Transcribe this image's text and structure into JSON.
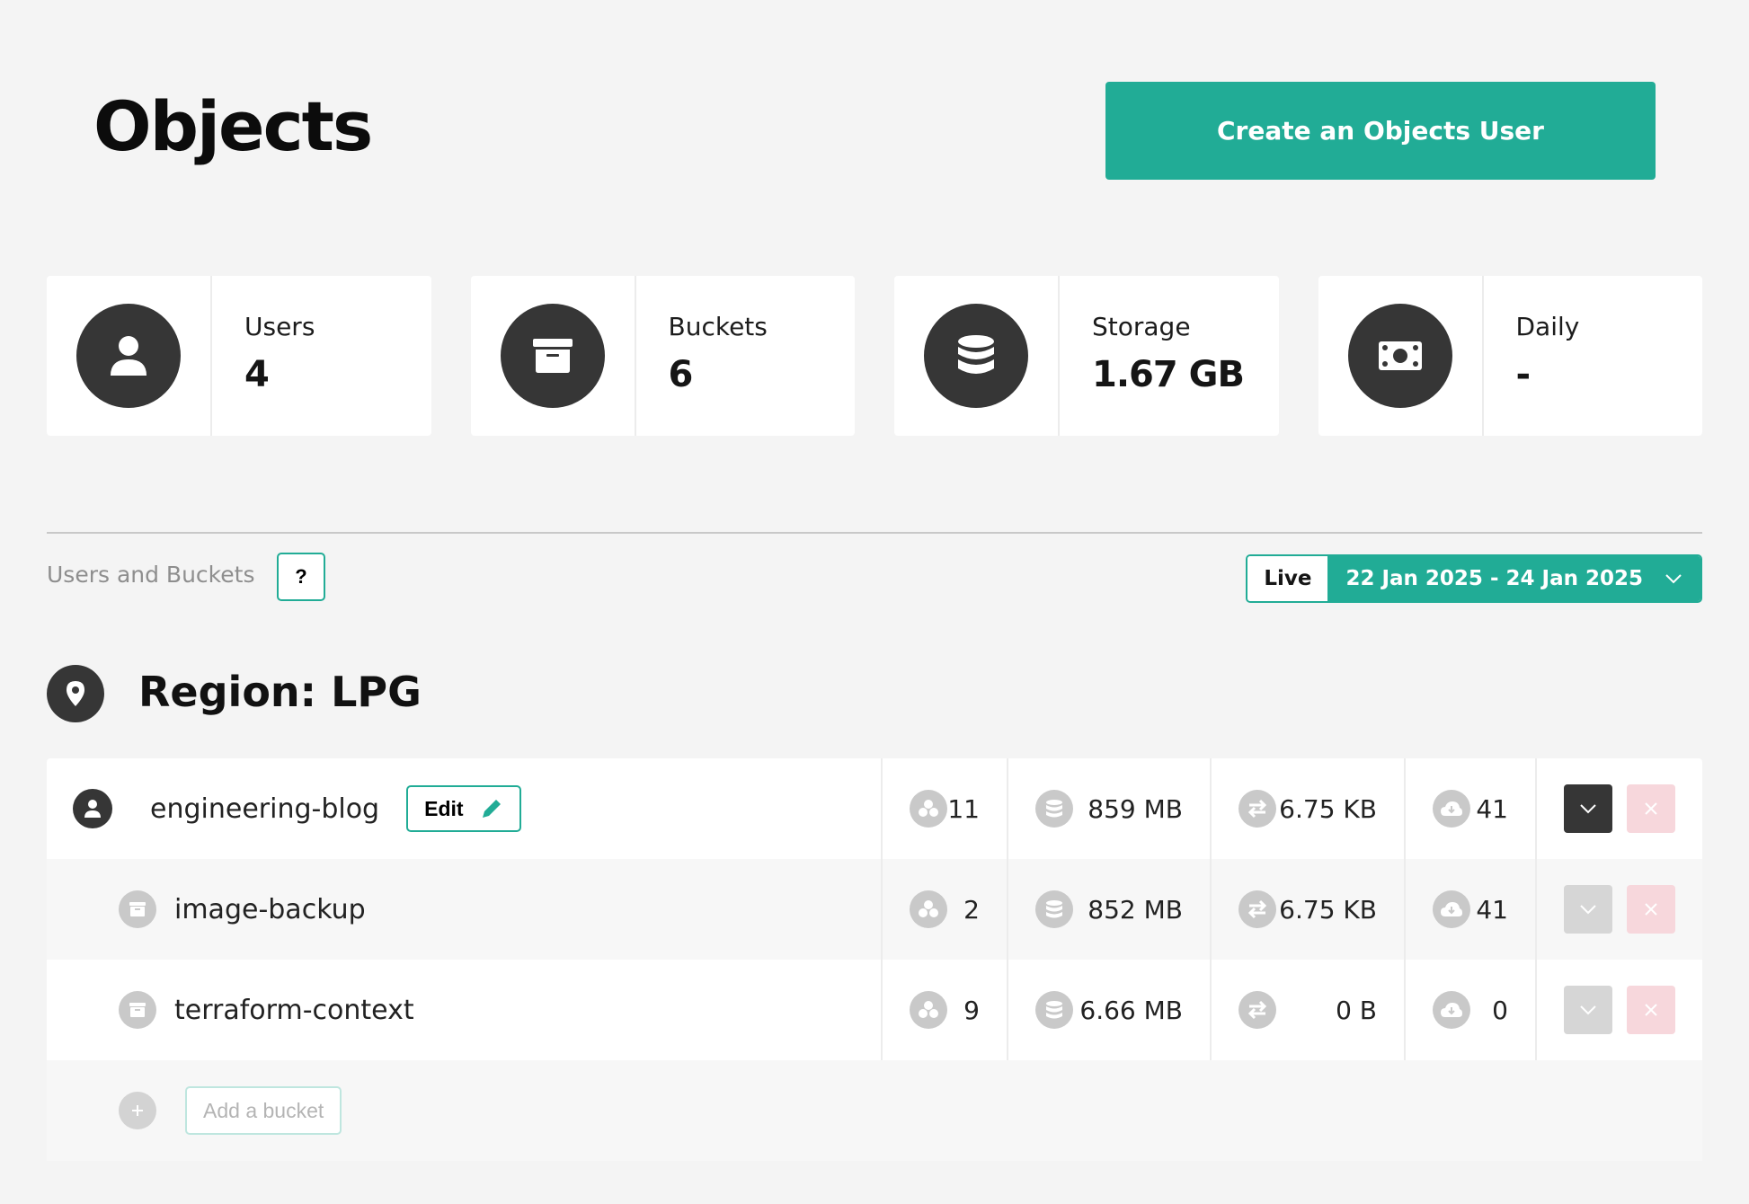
{
  "page": {
    "title": "Objects",
    "create_button": "Create an Objects User"
  },
  "stats": [
    {
      "label": "Users",
      "value": "4",
      "icon": "user-icon"
    },
    {
      "label": "Buckets",
      "value": "6",
      "icon": "archive-icon"
    },
    {
      "label": "Storage",
      "value": "1.67 GB",
      "icon": "database-icon"
    },
    {
      "label": "Daily",
      "value": "-",
      "icon": "money-icon"
    }
  ],
  "section": {
    "label": "Users and Buckets",
    "help": "?",
    "live": "Live",
    "date_range": "22 Jan 2025 - 24 Jan 2025"
  },
  "region": {
    "title": "Region: LPG"
  },
  "user_row": {
    "name": "engineering-blog",
    "edit": "Edit",
    "objects": "11",
    "storage": "859 MB",
    "transfer": "6.75 KB",
    "requests": "41"
  },
  "buckets": [
    {
      "name": "image-backup",
      "objects": "2",
      "storage": "852 MB",
      "transfer": "6.75 KB",
      "requests": "41"
    },
    {
      "name": "terraform-context",
      "objects": "9",
      "storage": "6.66 MB",
      "transfer": "0 B",
      "requests": "0"
    }
  ],
  "add_bucket": {
    "label": "Add a bucket"
  },
  "colors": {
    "accent": "#21ac96",
    "dark": "#363636",
    "danger_bg": "#f7d7dc"
  }
}
